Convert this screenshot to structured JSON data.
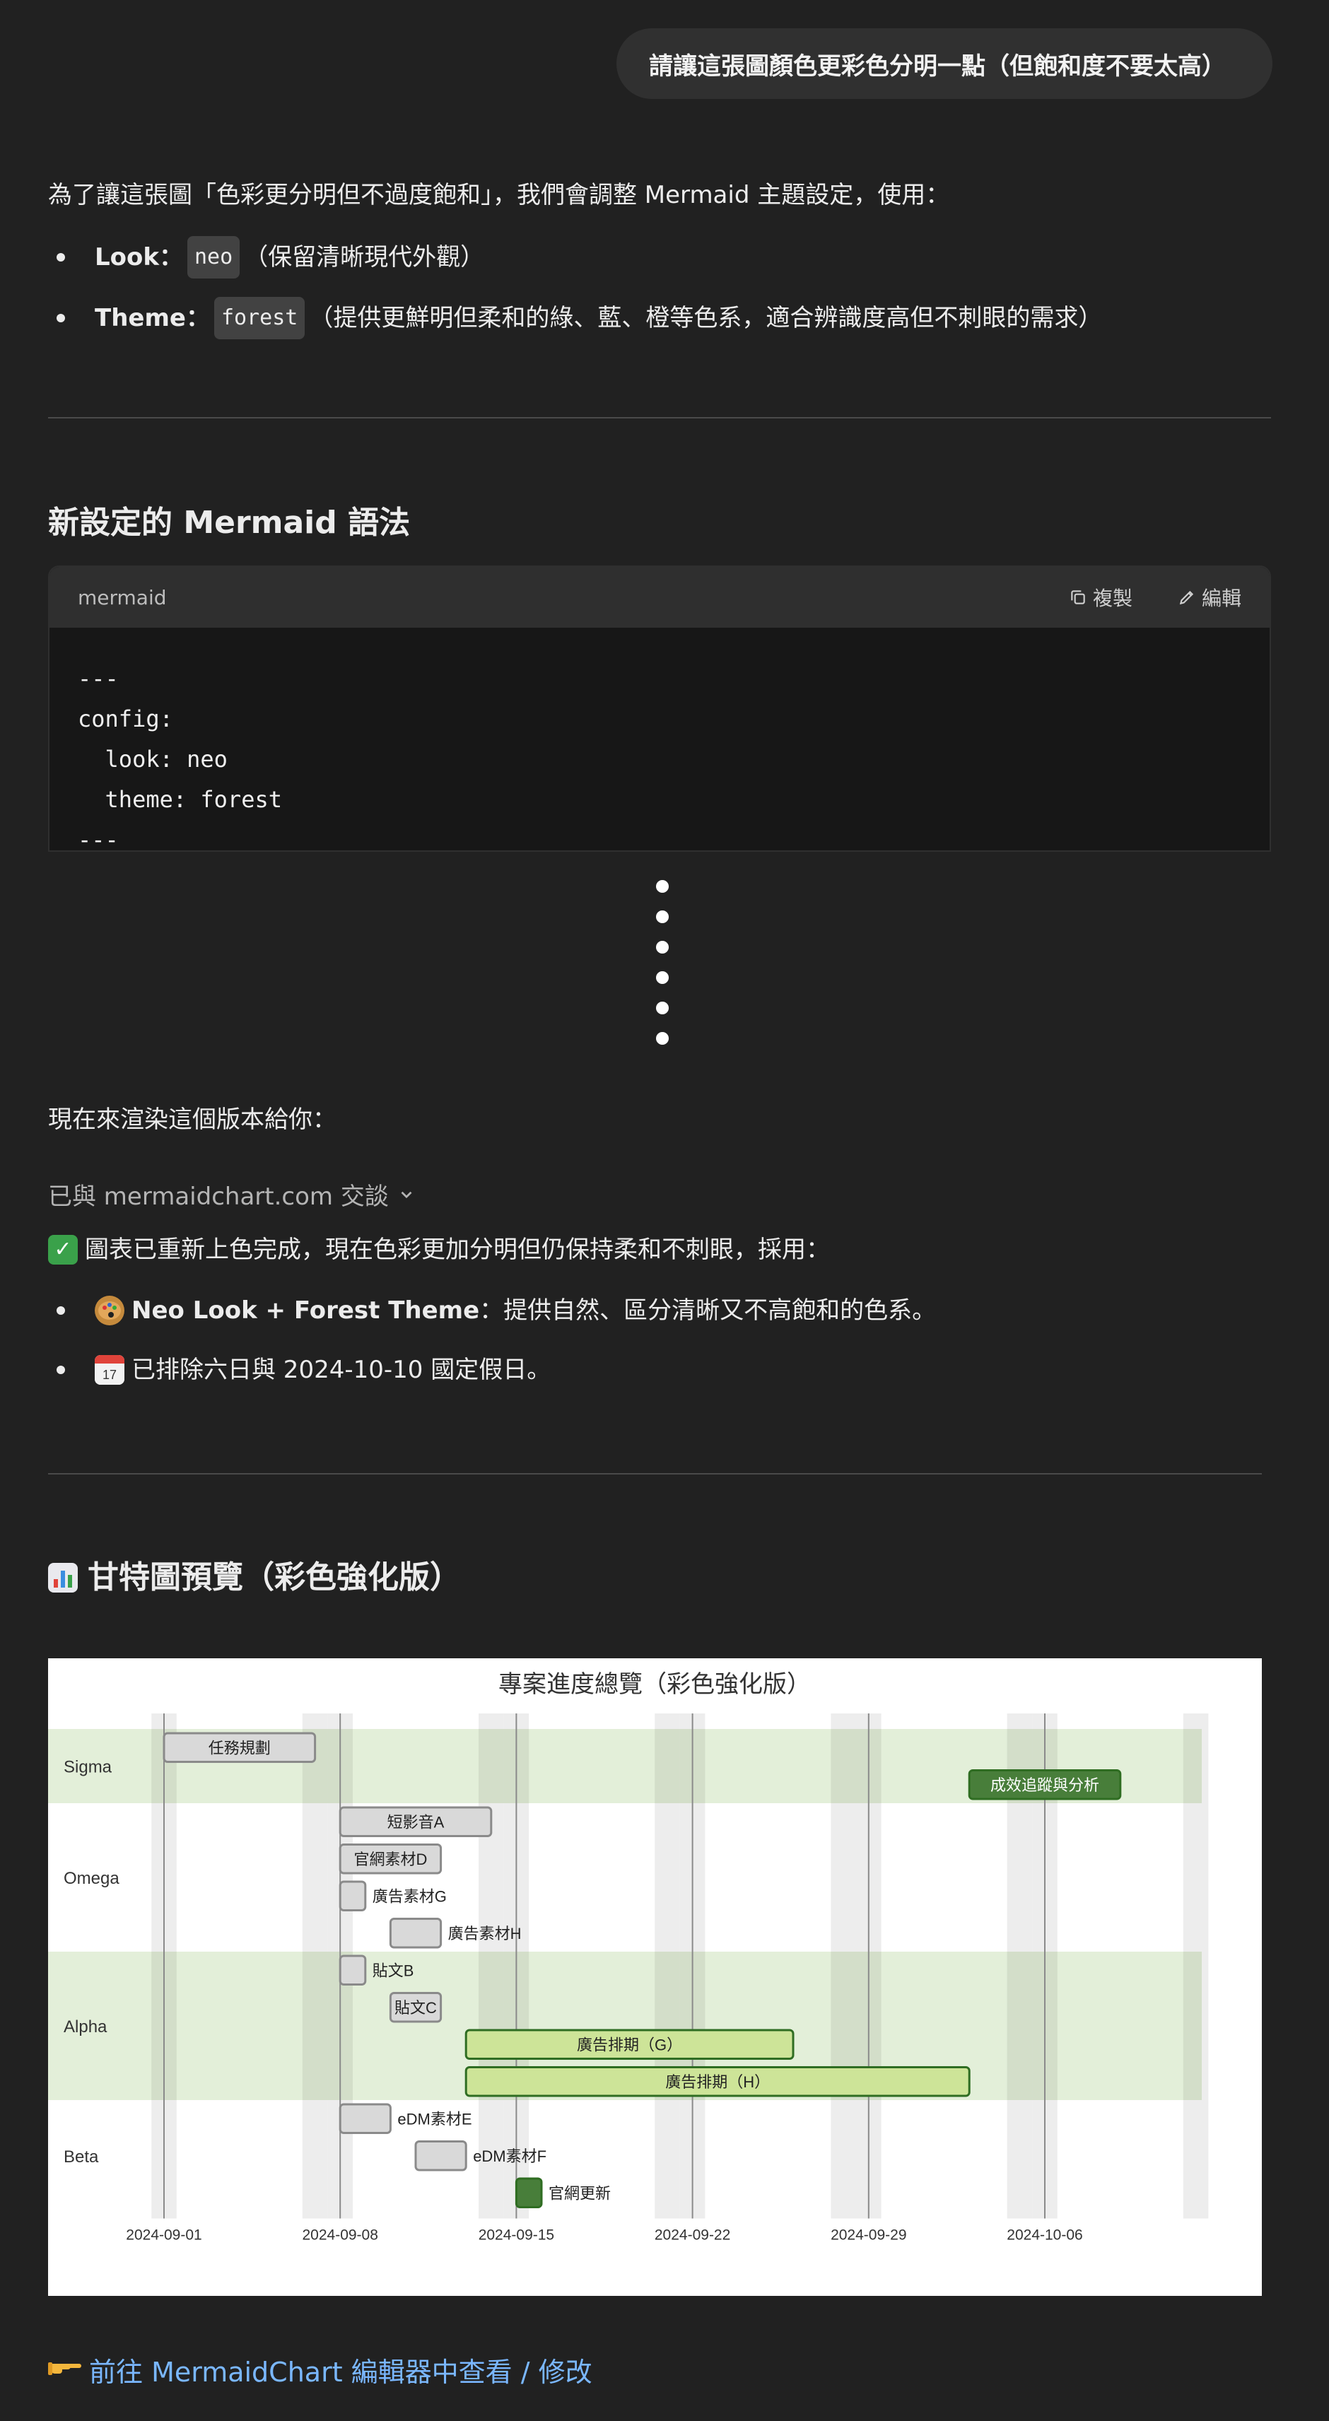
{
  "user_message": "請讓這張圖顏色更彩色分明一點（但飽和度不要太高）",
  "reply": {
    "intro": "為了讓這張圖「色彩更分明但不過度飽和」，我們會調整 Mermaid 主題設定，使用：",
    "bullets": [
      {
        "key": "Look：",
        "code": "neo",
        "desc": "（保留清晰現代外觀）"
      },
      {
        "key": "Theme：",
        "code": "forest",
        "desc": "（提供更鮮明但柔和的綠、藍、橙等色系，適合辨識度高但不刺眼的需求）"
      }
    ],
    "section_title": "新設定的 Mermaid 語法",
    "code_block": {
      "lang": "mermaid",
      "copy_label": "複製",
      "edit_label": "編輯",
      "lines": [
        "---",
        "config:",
        "  look: neo",
        "  theme: forest",
        "---"
      ]
    },
    "render_intro": "現在來渲染這個版本給你：",
    "tool_status": "已與 mermaidchart.com 交談",
    "done_line": "圖表已重新上色完成，現在色彩更加分明但仍保持柔和不刺眼，採用：",
    "done_bullets": [
      {
        "bold": "Neo Look + Forest Theme",
        "text": "：提供自然、區分清晰又不高飽和的色系。"
      },
      {
        "bold": "",
        "text": "已排除六日與 2024-10-10 國定假日。"
      }
    ],
    "preview_title": "甘特圖預覽（彩色強化版）",
    "link_text": "前往 MermaidChart 編輯器中查看 / 修改"
  },
  "icons": {
    "check": "check-mark-icon",
    "palette": "palette-icon",
    "calendar": "calendar-icon",
    "bar_chart": "bar-chart-icon",
    "pointing_hand": "pointing-hand-icon",
    "copy": "copy-icon",
    "edit": "edit-icon",
    "chevron": "chevron-down-icon"
  },
  "colors": {
    "background": "#212121",
    "link": "#7ab7ff",
    "task_default": "#d9d9d9",
    "task_active": "#cde498",
    "task_done": "#487e3a",
    "section_band": "#e3efd9"
  },
  "chart_data": {
    "type": "gantt",
    "title": "專案進度總覽（彩色強化版）",
    "x_ticks": [
      "2024-09-01",
      "2024-09-08",
      "2024-09-15",
      "2024-09-22",
      "2024-09-29",
      "2024-10-06"
    ],
    "sections": [
      "Sigma",
      "Omega",
      "Alpha",
      "Beta"
    ],
    "tasks": [
      {
        "section": "Sigma",
        "name": "任務規劃",
        "start": "2024-09-01",
        "end": "2024-09-07",
        "status": "default",
        "label_inside": true
      },
      {
        "section": "Sigma",
        "name": "成效追蹤與分析",
        "start": "2024-10-03",
        "end": "2024-10-09",
        "status": "done",
        "label_inside": true
      },
      {
        "section": "Omega",
        "name": "短影音A",
        "start": "2024-09-08",
        "end": "2024-09-14",
        "status": "default",
        "label_inside": true
      },
      {
        "section": "Omega",
        "name": "官網素材D",
        "start": "2024-09-08",
        "end": "2024-09-12",
        "status": "default",
        "label_inside": true
      },
      {
        "section": "Omega",
        "name": "廣告素材G",
        "start": "2024-09-08",
        "end": "2024-09-09",
        "status": "default",
        "label_inside": false
      },
      {
        "section": "Omega",
        "name": "廣告素材H",
        "start": "2024-09-10",
        "end": "2024-09-12",
        "status": "default",
        "label_inside": false
      },
      {
        "section": "Alpha",
        "name": "貼文B",
        "start": "2024-09-08",
        "end": "2024-09-09",
        "status": "default",
        "label_inside": false
      },
      {
        "section": "Alpha",
        "name": "貼文C",
        "start": "2024-09-10",
        "end": "2024-09-12",
        "status": "default",
        "label_inside": true
      },
      {
        "section": "Alpha",
        "name": "廣告排期（G）",
        "start": "2024-09-13",
        "end": "2024-09-26",
        "status": "active",
        "label_inside": true
      },
      {
        "section": "Alpha",
        "name": "廣告排期（H）",
        "start": "2024-09-13",
        "end": "2024-10-03",
        "status": "active",
        "label_inside": true
      },
      {
        "section": "Beta",
        "name": "eDM素材E",
        "start": "2024-09-08",
        "end": "2024-09-10",
        "status": "default",
        "label_inside": false
      },
      {
        "section": "Beta",
        "name": "eDM素材F",
        "start": "2024-09-11",
        "end": "2024-09-13",
        "status": "default",
        "label_inside": false
      },
      {
        "section": "Beta",
        "name": "官網更新",
        "start": "2024-09-15",
        "end": "2024-09-16",
        "status": "done",
        "label_inside": false
      }
    ],
    "excludes": "weekends, 2024-10-10"
  }
}
